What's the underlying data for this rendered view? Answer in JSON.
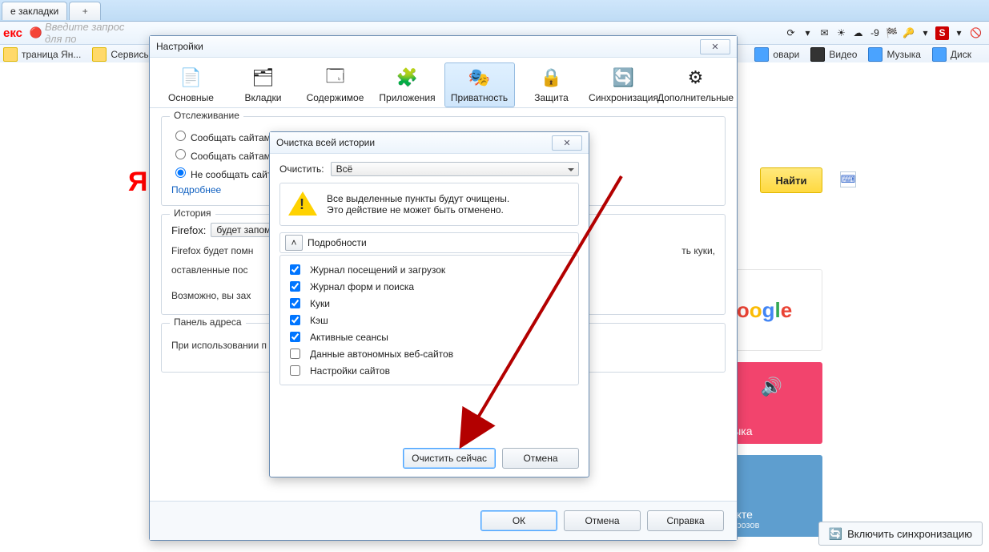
{
  "tabs": {
    "current": "е закладки",
    "plus": "+"
  },
  "addr": {
    "logo": "екс",
    "placeholder": "Введите запрос для по"
  },
  "addrIcons": {
    "temp": "-9"
  },
  "bookmarks": {
    "left": [
      {
        "label": "траница Ян..."
      },
      {
        "label": "Сервисы Яндекс"
      }
    ],
    "right": [
      {
        "label": "овари"
      },
      {
        "label": "Видео"
      },
      {
        "label": "Музыка"
      },
      {
        "label": "Диск"
      }
    ]
  },
  "page": {
    "ya": "Я",
    "searchBtn": "Найти",
    "cards": {
      "google": {
        "text": "oogle"
      },
      "music": {
        "label": "Музыка"
      },
      "vk": {
        "label": "онтакте",
        "sub": "ик Морозов"
      }
    }
  },
  "settings": {
    "title": "Настройки",
    "tabs": [
      {
        "key": "main",
        "label": "Основные"
      },
      {
        "key": "tabs",
        "label": "Вкладки"
      },
      {
        "key": "content",
        "label": "Содержимое"
      },
      {
        "key": "apps",
        "label": "Приложения"
      },
      {
        "key": "privacy",
        "label": "Приватность"
      },
      {
        "key": "security",
        "label": "Защита"
      },
      {
        "key": "sync",
        "label": "Синхронизация"
      },
      {
        "key": "advanced",
        "label": "Дополнительные"
      }
    ],
    "tracking": {
      "legend": "Отслеживание",
      "opt1": "Сообщать сайтам",
      "opt2": "Сообщать сайтам",
      "opt3": "Не сообщать сайт",
      "more": "Подробнее"
    },
    "history": {
      "legend": "История",
      "firefox": "Firefox:",
      "mode": "будет запом",
      "body1": "Firefox будет помн",
      "body2": "оставленные пос",
      "body3": "Возможно, вы зах",
      "bodytail": "ть куки,"
    },
    "addrPanel": {
      "legend": "Панель адреса",
      "line": "При использовании п"
    },
    "footerBtns": {
      "ok": "ОК",
      "cancel": "Отмена",
      "help": "Справка"
    }
  },
  "clear": {
    "title": "Очистка всей истории",
    "rangeLabel": "Очистить:",
    "rangeValue": "Всё",
    "warn1": "Все выделенные пункты будут очищены.",
    "warn2": "Это действие не может быть отменено.",
    "details": "Подробности",
    "items": [
      {
        "label": "Журнал посещений и загрузок",
        "checked": true
      },
      {
        "label": "Журнал форм и поиска",
        "checked": true
      },
      {
        "label": "Куки",
        "checked": true
      },
      {
        "label": "Кэш",
        "checked": true
      },
      {
        "label": "Активные сеансы",
        "checked": true
      },
      {
        "label": "Данные автономных веб-сайтов",
        "checked": false
      },
      {
        "label": "Настройки сайтов",
        "checked": false
      }
    ],
    "clearNow": "Очистить сейчас",
    "cancel": "Отмена"
  },
  "sync": {
    "label": "Включить синхронизацию"
  }
}
